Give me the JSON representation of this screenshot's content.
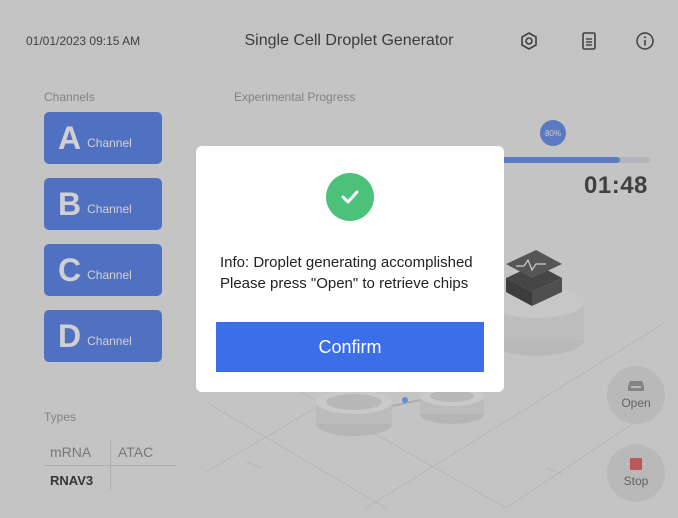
{
  "header": {
    "datetime": "01/01/2023 09:15 AM",
    "title": "Single Cell Droplet Generator",
    "icons": [
      "settings-icon",
      "document-icon",
      "info-icon"
    ]
  },
  "channels": {
    "label": "Channels",
    "items": [
      {
        "letter": "A",
        "label": "Channel"
      },
      {
        "letter": "B",
        "label": "Channel"
      },
      {
        "letter": "C",
        "label": "Channel"
      },
      {
        "letter": "D",
        "label": "Channel"
      }
    ]
  },
  "types": {
    "label": "Types",
    "headers": [
      "mRNA",
      "ATAC"
    ],
    "rows": [
      [
        "RNAV3",
        ""
      ]
    ]
  },
  "progress": {
    "label": "Experimental Progress",
    "percent_label": "80%",
    "fraction": 0.8,
    "timer": "01:48"
  },
  "actions": {
    "open_label": "Open",
    "stop_label": "Stop"
  },
  "dialog": {
    "line1": "Info: Droplet generating accomplished",
    "line2": "Please press \"Open\" to retrieve chips",
    "confirm_label": "Confirm"
  },
  "colors": {
    "primary": "#3b6ee8",
    "success": "#4cc17a",
    "stop": "#e0484e"
  }
}
